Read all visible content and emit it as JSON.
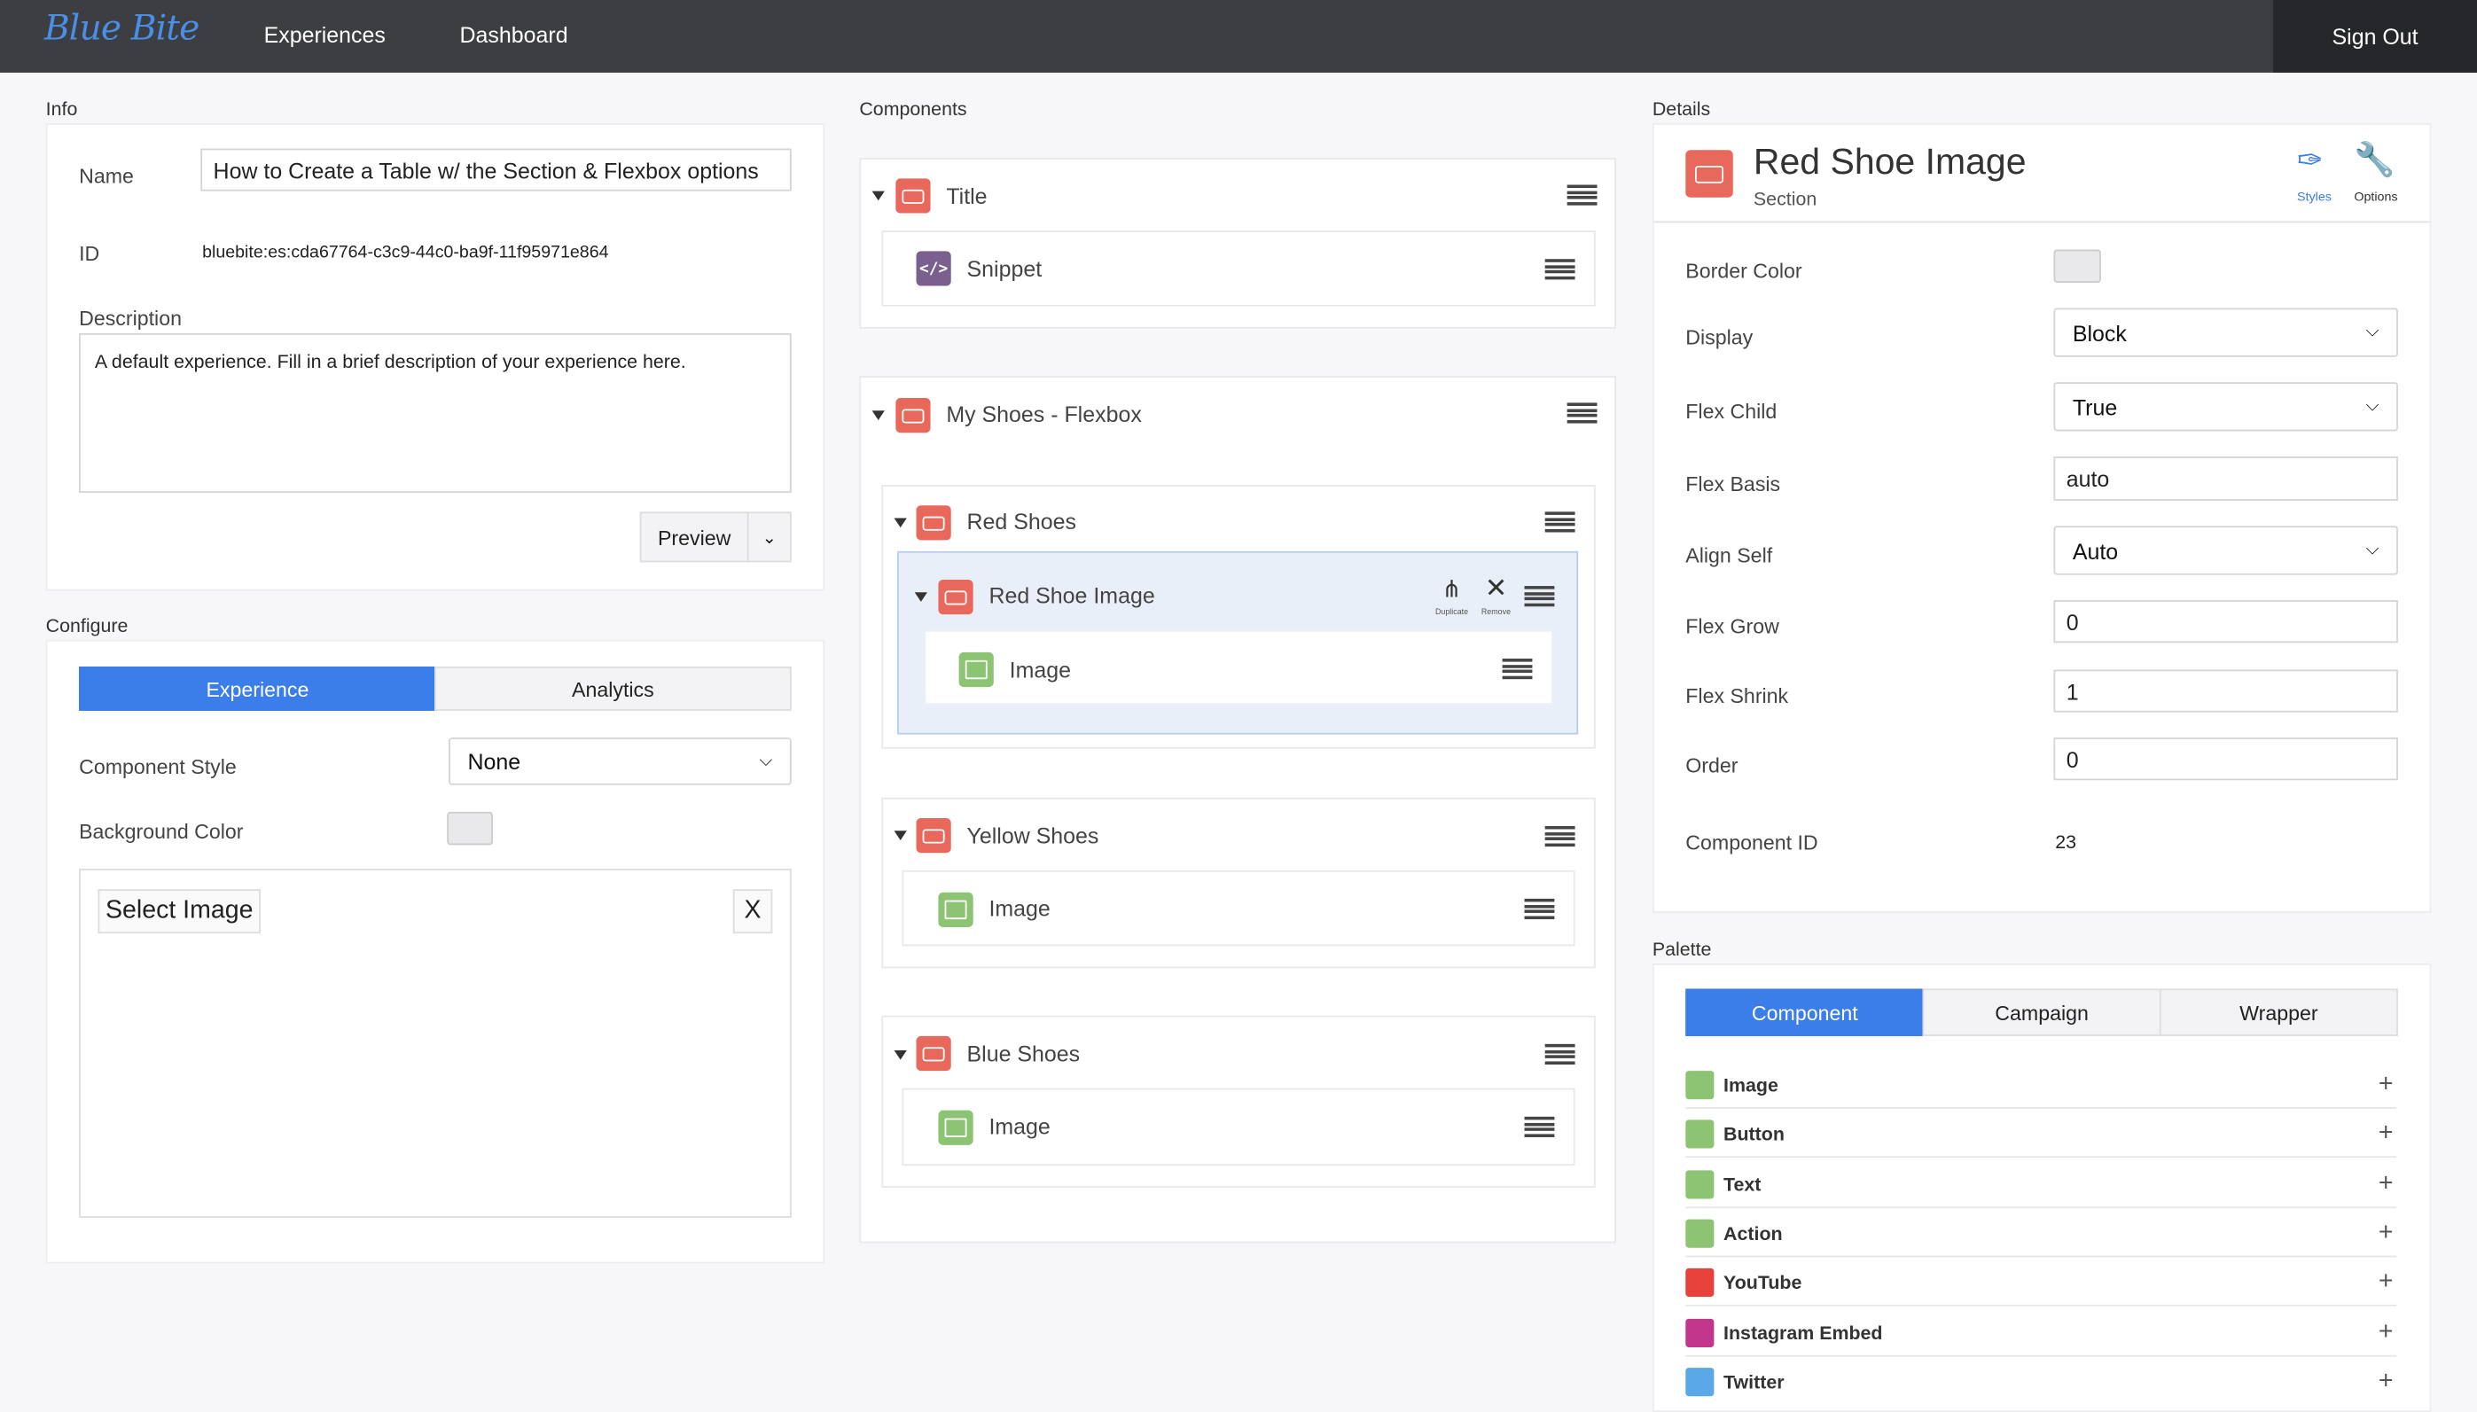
{
  "nav": {
    "logo": "Blue Bite",
    "links": [
      "Experiences",
      "Dashboard"
    ],
    "signout": "Sign Out"
  },
  "info": {
    "section": "Info",
    "name_label": "Name",
    "name_value": "How to Create a Table w/ the Section & Flexbox options",
    "id_label": "ID",
    "id_value": "bluebite:es:cda67764-c3c9-44c0-ba9f-11f95971e864",
    "desc_label": "Description",
    "desc_value": "A default experience. Fill in a brief description of your experience here.",
    "preview": "Preview"
  },
  "configure": {
    "section": "Configure",
    "tabs": [
      "Experience",
      "Analytics"
    ],
    "style_label": "Component Style",
    "style_value": "None",
    "bg_label": "Background Color",
    "select_image": "Select Image",
    "clear": "X"
  },
  "components": {
    "section": "Components",
    "title": {
      "label": "Title",
      "child": "Snippet"
    },
    "flexbox": {
      "label": "My Shoes - Flexbox"
    },
    "red": {
      "label": "Red Shoes",
      "selected": "Red Shoe Image",
      "child": "Image",
      "duplicate": "Duplicate",
      "remove": "Remove"
    },
    "yellow": {
      "label": "Yellow Shoes",
      "child": "Image"
    },
    "blue": {
      "label": "Blue Shoes",
      "child": "Image"
    }
  },
  "details": {
    "section": "Details",
    "title": "Red Shoe Image",
    "subtitle": "Section",
    "styles": "Styles",
    "options": "Options",
    "border_color": "Border Color",
    "display": "Display",
    "display_value": "Block",
    "flex_child": "Flex Child",
    "flex_child_value": "True",
    "flex_basis": "Flex Basis",
    "flex_basis_value": "auto",
    "align_self": "Align Self",
    "align_self_value": "Auto",
    "flex_grow": "Flex Grow",
    "flex_grow_value": "0",
    "flex_shrink": "Flex Shrink",
    "flex_shrink_value": "1",
    "order": "Order",
    "order_value": "0",
    "component_id": "Component ID",
    "component_id_value": "23"
  },
  "palette": {
    "section": "Palette",
    "tabs": [
      "Component",
      "Campaign",
      "Wrapper"
    ],
    "items": [
      {
        "label": "Image",
        "color": "#8cc474"
      },
      {
        "label": "Button",
        "color": "#8cc474"
      },
      {
        "label": "Text",
        "color": "#8cc474"
      },
      {
        "label": "Action",
        "color": "#8cc474"
      },
      {
        "label": "YouTube",
        "color": "#e8403a"
      },
      {
        "label": "Instagram Embed",
        "color": "#c1358a"
      },
      {
        "label": "Twitter",
        "color": "#5aa8e8"
      }
    ]
  },
  "colors": {
    "accent": "#3b7de9",
    "nav": "#3c3e42",
    "section_icon": "#e8685c"
  }
}
